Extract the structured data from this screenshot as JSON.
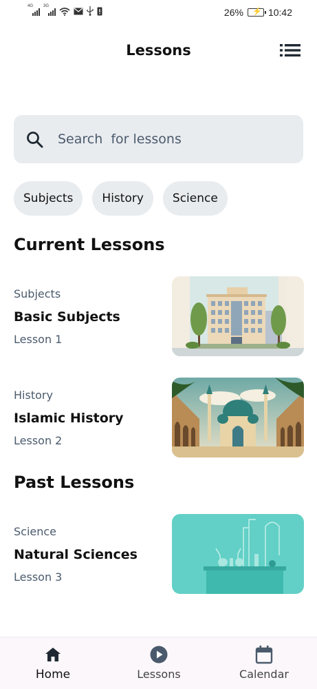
{
  "status_bar": {
    "network_1": "4G",
    "network_2": "3G",
    "battery_percent": "26%",
    "time": "10:42",
    "icons": [
      "signal-icon",
      "signal-icon",
      "wifi-icon",
      "mail-icon",
      "usb-icon",
      "sim-alert-icon",
      "battery-charging-icon"
    ]
  },
  "header": {
    "title": "Lessons",
    "menu_icon": "list-icon"
  },
  "search": {
    "placeholder": "Search  for lessons",
    "value": "",
    "icon": "search-icon"
  },
  "chips": [
    {
      "label": "Subjects"
    },
    {
      "label": "History"
    },
    {
      "label": "Science"
    }
  ],
  "current_lessons": {
    "title": "Current Lessons",
    "items": [
      {
        "category": "Subjects",
        "name": "Basic Subjects",
        "lesson": "Lesson 1",
        "image": "school-building-illustration"
      },
      {
        "category": "History",
        "name": "Islamic History",
        "lesson": "Lesson 2",
        "image": "mosque-illustration"
      }
    ]
  },
  "past_lessons": {
    "title": "Past Lessons",
    "items": [
      {
        "category": "Science",
        "name": "Natural Sciences",
        "lesson": "Lesson 3",
        "image": "laboratory-illustration"
      }
    ]
  },
  "bottom_nav": {
    "items": [
      {
        "label": "Home",
        "icon": "home-icon",
        "active": true
      },
      {
        "label": "Lessons",
        "icon": "play-circle-icon",
        "active": false
      },
      {
        "label": "Calendar",
        "icon": "calendar-icon",
        "active": false
      }
    ]
  },
  "colors": {
    "background": "#ffffff",
    "surface": "#e9ecef",
    "muted_text": "#4a5a6c",
    "primary_text": "#111418",
    "nav_background": "#fcf7fb",
    "icon_active": "#1f2933",
    "icon_inactive": "#4a5a6c"
  }
}
